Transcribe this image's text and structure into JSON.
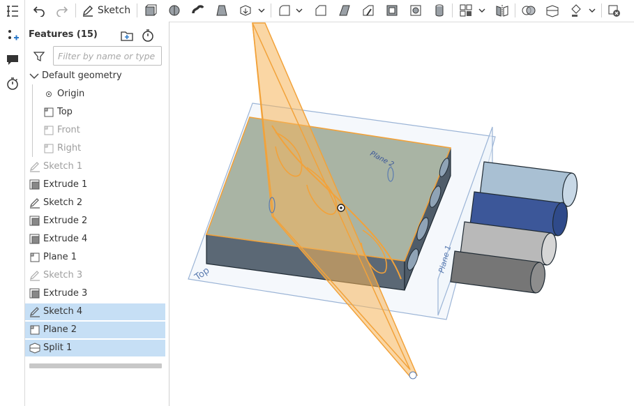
{
  "toolbar": {
    "sketch_label": "Sketch"
  },
  "features": {
    "title": "Features (15)",
    "filter_placeholder": "Filter by name or type",
    "items": [
      {
        "label": "Default geometry",
        "icon": "chevron-down-icon"
      },
      {
        "label": "Origin",
        "icon": "origin-icon"
      },
      {
        "label": "Top",
        "icon": "plane-icon"
      },
      {
        "label": "Front",
        "icon": "plane-icon"
      },
      {
        "label": "Right",
        "icon": "plane-icon"
      },
      {
        "label": "Sketch 1",
        "icon": "sketch-icon"
      },
      {
        "label": "Extrude 1",
        "icon": "extrude-icon"
      },
      {
        "label": "Sketch 2",
        "icon": "sketch-icon"
      },
      {
        "label": "Extrude 2",
        "icon": "extrude-icon"
      },
      {
        "label": "Extrude 4",
        "icon": "extrude-icon"
      },
      {
        "label": "Plane 1",
        "icon": "plane-icon"
      },
      {
        "label": "Sketch 3",
        "icon": "sketch-icon"
      },
      {
        "label": "Extrude 3",
        "icon": "extrude-icon"
      },
      {
        "label": "Sketch 4",
        "icon": "sketch-icon"
      },
      {
        "label": "Plane 2",
        "icon": "plane-icon"
      },
      {
        "label": "Split 1",
        "icon": "split-icon"
      }
    ]
  },
  "viewport": {
    "plane_label_top": "Top",
    "plane_label_plane1": "Plane 1",
    "plane_label_plane2": "Plane 2",
    "accent_color": "#f2a23a",
    "selection_color": "#c6dff5"
  }
}
